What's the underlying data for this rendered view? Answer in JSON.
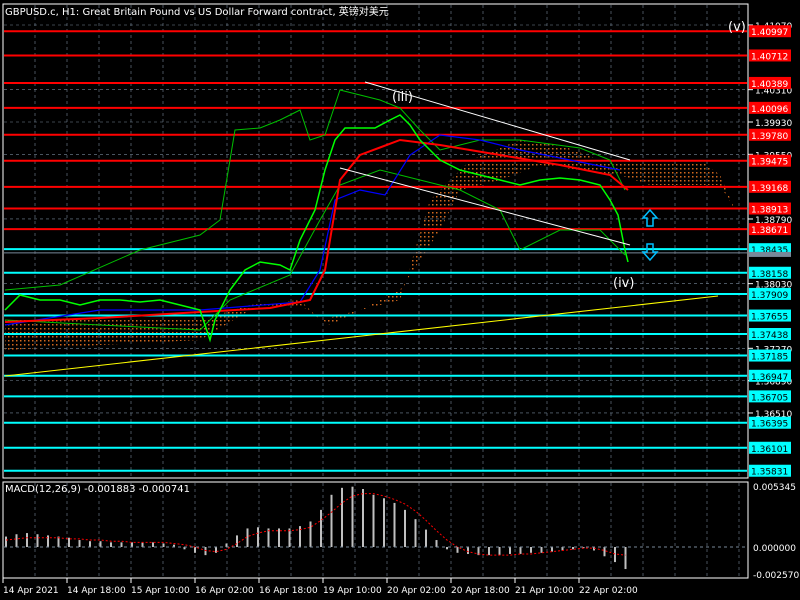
{
  "header": {
    "title": "GBPUSD.c, H1:  Great Britain Pound vs US Dollar Forward contract, 英镑对美元"
  },
  "macd_panel": {
    "label": "MACD(12,26,9) -0.001883 -0.000741"
  },
  "chart_data": {
    "type": "line",
    "symbol": "GBPUSD.c",
    "timeframe": "H1",
    "price_axis_ticks": [
      "1.41070",
      "1.40310",
      "1.39930",
      "1.39550",
      "1.38790",
      "1.38030",
      "1.37270",
      "1.36890",
      "1.36510"
    ],
    "resistance_levels": [
      "1.40997",
      "1.40712",
      "1.40389",
      "1.40096",
      "1.39780",
      "1.39475",
      "1.39168",
      "1.38913",
      "1.38671"
    ],
    "support_levels": [
      "1.38435",
      "1.38158",
      "1.37909",
      "1.37655",
      "1.37438",
      "1.37185",
      "1.36947",
      "1.36705",
      "1.36395",
      "1.36101",
      "1.35831"
    ],
    "current_price": "1.38391",
    "colors": {
      "resistance": "#ff0000",
      "support": "#00ffff",
      "candles": "#00ff00",
      "bands": "#00c000",
      "ma_red": "#ff0000",
      "ma_blue": "#0000ff",
      "cloud": "#d2691e",
      "trend": "#ffff00"
    },
    "wave_labels": [
      "(iii)",
      "(iv)",
      "(v)"
    ],
    "time_labels": [
      "14 Apr 2021",
      "14 Apr 18:00",
      "15 Apr 10:00",
      "16 Apr 02:00",
      "16 Apr 18:00",
      "19 Apr 10:00",
      "20 Apr 02:00",
      "20 Apr 18:00",
      "21 Apr 10:00",
      "22 Apr 02:00"
    ],
    "macd": {
      "params": "12,26,9",
      "axis_ticks": [
        "0.005345",
        "0.000000",
        "-0.002570"
      ],
      "ylim": [
        -0.00257,
        0.005345
      ],
      "histogram": [
        0.0009,
        0.0011,
        0.0012,
        0.0011,
        0.001,
        0.0009,
        0.0008,
        0.0006,
        0.0005,
        0.0005,
        0.0004,
        0.0004,
        0.0004,
        0.0004,
        0.0004,
        0.0003,
        0.0002,
        -0.0002,
        -0.0005,
        -0.0007,
        -0.0005,
        0.0003,
        0.001,
        0.0016,
        0.0017,
        0.0016,
        0.0016,
        0.0016,
        0.0018,
        0.0022,
        0.0032,
        0.0045,
        0.0051,
        0.0052,
        0.005,
        0.0045,
        0.0042,
        0.0038,
        0.0032,
        0.0024,
        0.0015,
        0.0006,
        -0.0002,
        -0.0005,
        -0.0006,
        -0.0007,
        -0.0007,
        -0.0007,
        -0.0006,
        -0.0006,
        -0.0005,
        -0.0005,
        -0.0004,
        -0.0003,
        -0.0002,
        -0.0001,
        -0.0003,
        -0.0008,
        -0.0013,
        -0.0019
      ],
      "signal": [
        0.0006,
        0.0007,
        0.0008,
        0.0008,
        0.0008,
        0.0008,
        0.0007,
        0.0007,
        0.0006,
        0.0006,
        0.0005,
        0.0005,
        0.0004,
        0.0004,
        0.0004,
        0.0004,
        0.0003,
        0.0002,
        0.0,
        -0.0003,
        -0.0004,
        -0.0002,
        0.0003,
        0.0009,
        0.0012,
        0.0014,
        0.0014,
        0.0014,
        0.0015,
        0.0017,
        0.0023,
        0.003,
        0.0038,
        0.0044,
        0.0046,
        0.0046,
        0.0044,
        0.0041,
        0.0037,
        0.0031,
        0.0023,
        0.0014,
        0.0006,
        0.0,
        -0.0004,
        -0.0006,
        -0.0007,
        -0.0007,
        -0.0007,
        -0.0006,
        -0.0006,
        -0.0005,
        -0.0004,
        -0.0003,
        -0.0002,
        -0.0001,
        -0.0001,
        -0.0003,
        -0.0006,
        -0.0007
      ]
    }
  }
}
